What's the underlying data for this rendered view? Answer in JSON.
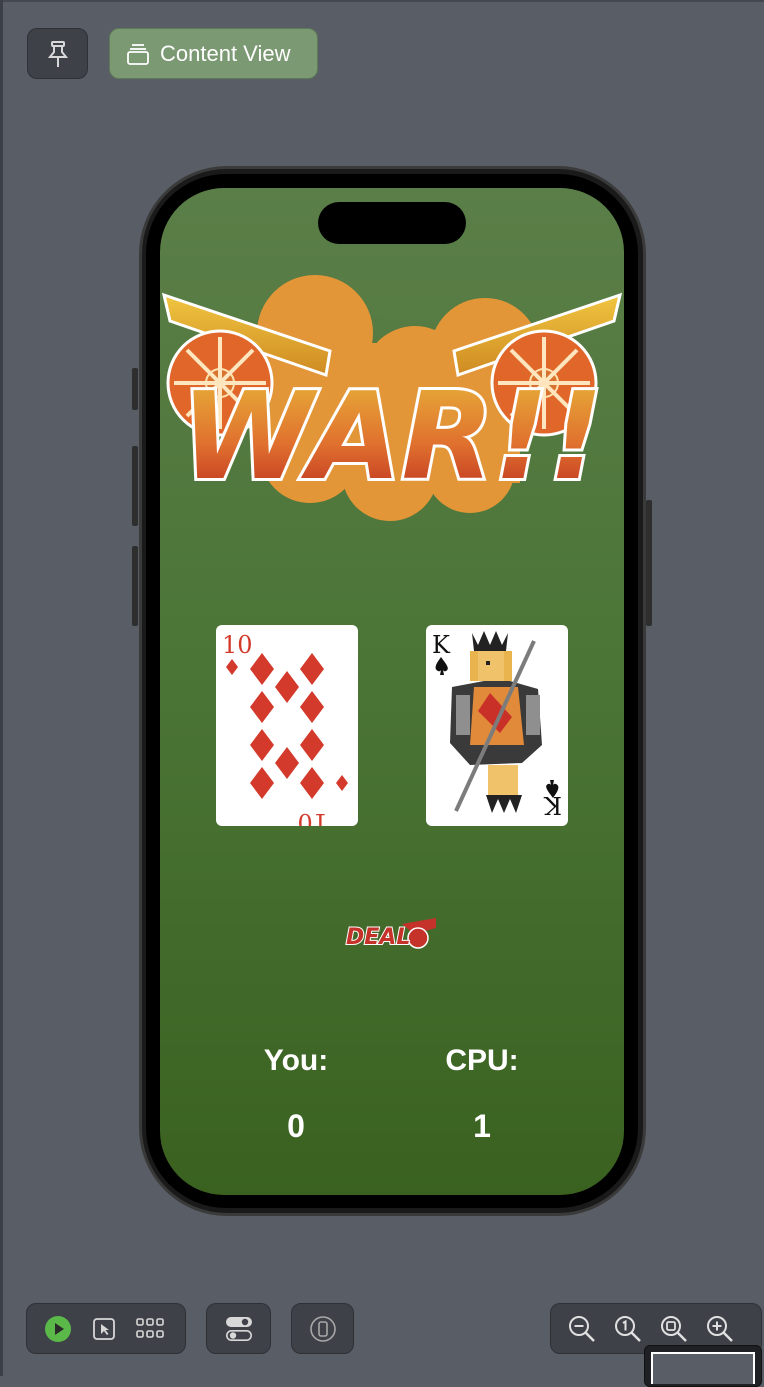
{
  "toolbar": {
    "pin_icon": "pin-icon",
    "content_view_label": "Content View",
    "content_view_icon": "stack-icon"
  },
  "app": {
    "title_logo_text": "WAR!!",
    "deal_button_text": "DEAL",
    "player_card": {
      "rank": "10",
      "suit": "diamonds",
      "color": "#d33a2c"
    },
    "cpu_card": {
      "rank": "K",
      "suit": "spades",
      "color": "#111111"
    },
    "player_label": "You:",
    "cpu_label": "CPU:",
    "player_score": "0",
    "cpu_score": "1"
  },
  "bottom_toolbar": {
    "play_icon": "play-icon",
    "select_icon": "cursor-select-icon",
    "grid_icon": "grid-icon",
    "variants_icon": "toggles-icon",
    "device_icon": "device-icon",
    "zoom_out_icon": "zoom-out-icon",
    "zoom_actual_icon": "zoom-100-icon",
    "zoom_fit_icon": "zoom-fit-icon",
    "zoom_in_icon": "zoom-in-icon"
  },
  "colors": {
    "canvas_bg": "#595d66",
    "screen_green_top": "#5b7e48",
    "screen_green_bottom": "#3a611f",
    "accent_button": "#7b9973",
    "play_green": "#5bb94a"
  }
}
